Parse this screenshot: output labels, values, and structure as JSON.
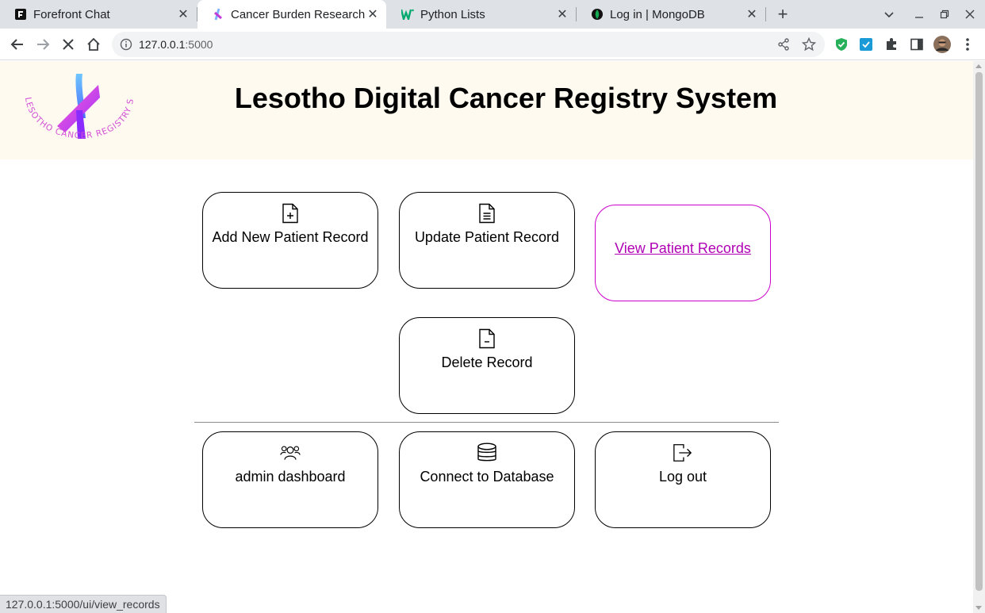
{
  "browser": {
    "tabs": [
      {
        "title": "Forefront Chat",
        "active": false
      },
      {
        "title": "Cancer Burden Research P",
        "active": true
      },
      {
        "title": "Python Lists",
        "active": false
      },
      {
        "title": "Log in | MongoDB",
        "active": false
      }
    ],
    "url_host": "127.0.0.1",
    "url_port": ":5000",
    "status_url": "127.0.0.1:5000/ui/view_records"
  },
  "page": {
    "title": "Lesotho Digital Cancer Registry System",
    "logo_text": "LESOTHO CANCER REGISTRY SYSTEM",
    "cards": {
      "add": {
        "label": "Add New Patient Record",
        "icon": "file-plus-icon"
      },
      "update": {
        "label": "Update Patient Record",
        "icon": "file-text-icon"
      },
      "view": {
        "label": "View Patient Records"
      },
      "delete": {
        "label": "Delete Record",
        "icon": "file-minus-icon"
      },
      "admin": {
        "label": "admin dashboard",
        "icon": "people-icon"
      },
      "database": {
        "label": "Connect to Database",
        "icon": "database-icon"
      },
      "logout": {
        "label": "Log out",
        "icon": "box-arrow-right-icon"
      }
    }
  },
  "colors": {
    "header_bg": "#fefaef",
    "highlight": "#cc00cc",
    "tabbar": "#dee1e6"
  }
}
